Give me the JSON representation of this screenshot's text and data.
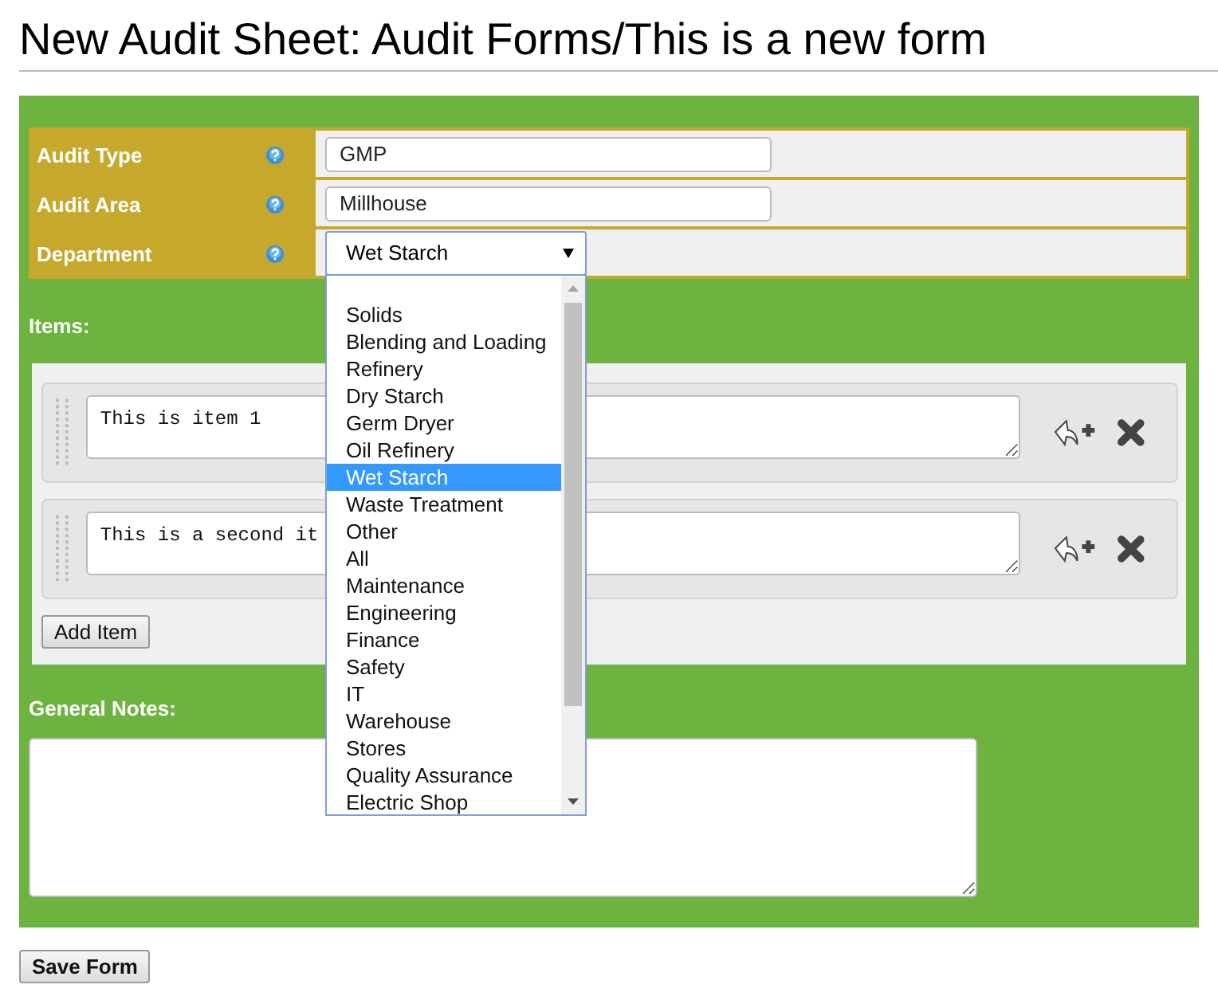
{
  "title": "New Audit Sheet: Audit Forms/This is a new form",
  "fields": [
    {
      "label": "Audit Type",
      "kind": "text",
      "value": "GMP"
    },
    {
      "label": "Audit Area",
      "kind": "text",
      "value": "Millhouse"
    },
    {
      "label": "Department",
      "kind": "select",
      "value": "Wet Starch",
      "expanded": true
    }
  ],
  "department_options": [
    {
      "label": "Solids",
      "selected": false
    },
    {
      "label": "Blending and Loading",
      "selected": false
    },
    {
      "label": "Refinery",
      "selected": false
    },
    {
      "label": "Dry Starch",
      "selected": false
    },
    {
      "label": "Germ Dryer",
      "selected": false
    },
    {
      "label": "Oil Refinery",
      "selected": false
    },
    {
      "label": "Wet Starch",
      "selected": true
    },
    {
      "label": "Waste Treatment",
      "selected": false
    },
    {
      "label": "Other",
      "selected": false
    },
    {
      "label": "All",
      "selected": false
    },
    {
      "label": "Maintenance",
      "selected": false
    },
    {
      "label": "Engineering",
      "selected": false
    },
    {
      "label": "Finance",
      "selected": false
    },
    {
      "label": "Safety",
      "selected": false
    },
    {
      "label": "IT",
      "selected": false
    },
    {
      "label": "Warehouse",
      "selected": false
    },
    {
      "label": "Stores",
      "selected": false
    },
    {
      "label": "Quality Assurance",
      "selected": false
    },
    {
      "label": "Electric Shop",
      "selected": false
    }
  ],
  "items_label": "Items:",
  "items": [
    {
      "text": "This is item 1"
    },
    {
      "text": "This is a second it"
    }
  ],
  "add_item_button": "Add Item",
  "notes_label": "General Notes:",
  "save_button": "Save Form"
}
